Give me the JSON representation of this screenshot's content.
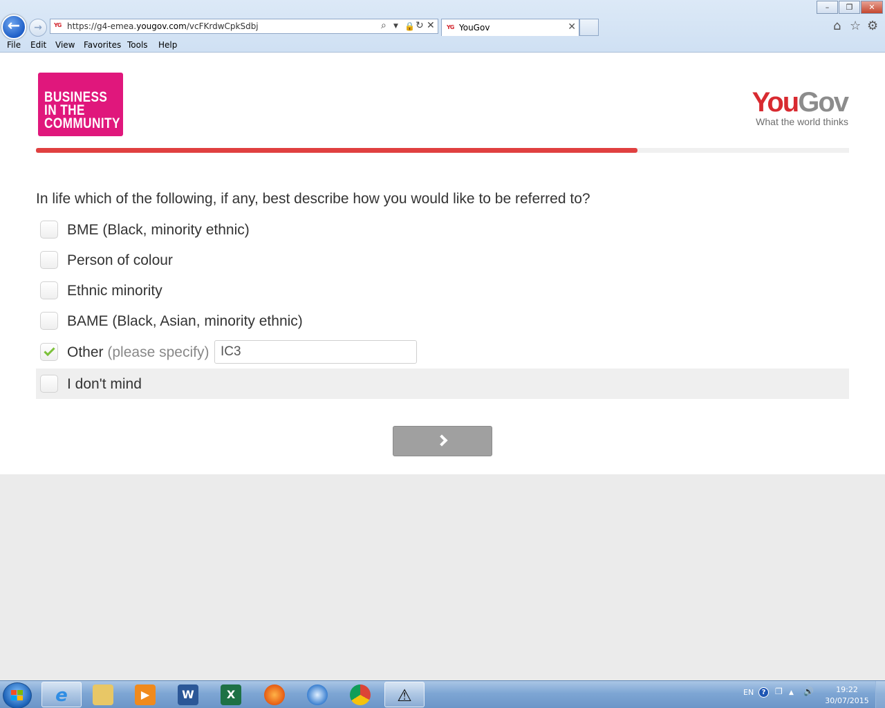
{
  "browser": {
    "url_prefix": "https://g4-emea.",
    "url_domain": "yougov.com",
    "url_path": "/vcFKrdwCpkSdbj",
    "favicon_text": "YG",
    "tab_title": "YouGov",
    "menu": [
      "File",
      "Edit",
      "View",
      "Favorites",
      "Tools",
      "Help"
    ]
  },
  "page": {
    "bitc_logo_lines": [
      "BUSINESS",
      "IN THE",
      "COMMUNITY"
    ],
    "yougov_logo": {
      "you": "You",
      "gov": "Gov",
      "tagline": "What the world thinks"
    },
    "progress_fraction": 0.74,
    "question": "In life which of the following, if any, best describe how you would like to be referred to?",
    "options": [
      {
        "label": "BME (Black, minority ethnic)",
        "checked": false
      },
      {
        "label": "Person of colour",
        "checked": false
      },
      {
        "label": "Ethnic minority",
        "checked": false
      },
      {
        "label": "BAME (Black, Asian, minority ethnic)",
        "checked": false
      },
      {
        "label": "Other",
        "hint": "(please specify)",
        "checked": true,
        "input_value": "IC3"
      },
      {
        "label": "I don't mind",
        "checked": false
      }
    ],
    "accent_color": "#e04040",
    "check_color": "#7cc13a"
  },
  "taskbar": {
    "language": "EN",
    "time": "19:22",
    "date": "30/07/2015",
    "apps": [
      "internet-explorer",
      "file-explorer",
      "media-player",
      "word",
      "excel",
      "firefox",
      "safari",
      "chrome",
      "warning-app"
    ]
  }
}
